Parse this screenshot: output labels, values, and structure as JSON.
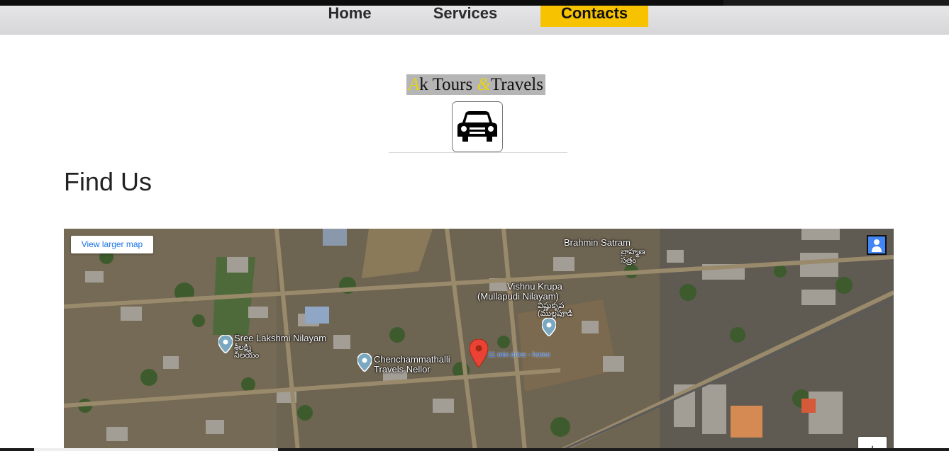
{
  "nav": {
    "home": "Home",
    "services": "Services",
    "contacts": "Contacts",
    "active_color": "#f7c200"
  },
  "brand": {
    "part1": "A",
    "part2": "k Tours ",
    "part3": "&",
    "part4": "Travels"
  },
  "car_icon": "car-icon",
  "page_title": "Find Us",
  "map": {
    "view_larger": "View larger map",
    "zoom_in": "+",
    "labels": {
      "brahmin_en": "Brahmin Satram",
      "brahmin_te1": "బ్రాహ్మణ",
      "brahmin_te2": "సత్రం",
      "vishnu_en1": "Vishnu Krupa",
      "vishnu_en2": "(Mullapudi Nilayam)",
      "vishnu_te1": "విష్ణుకృప",
      "vishnu_te2": "(ముల్లపూడి",
      "sree_en": "Sree Lakshmi Nilayam",
      "sree_te1": "శ్రీలక్ష్మి",
      "sree_te2": "నిలయం",
      "chench1": "Chenchammathalli",
      "chench2": "Travels Nellor",
      "drive": "11 min drive - home"
    }
  }
}
